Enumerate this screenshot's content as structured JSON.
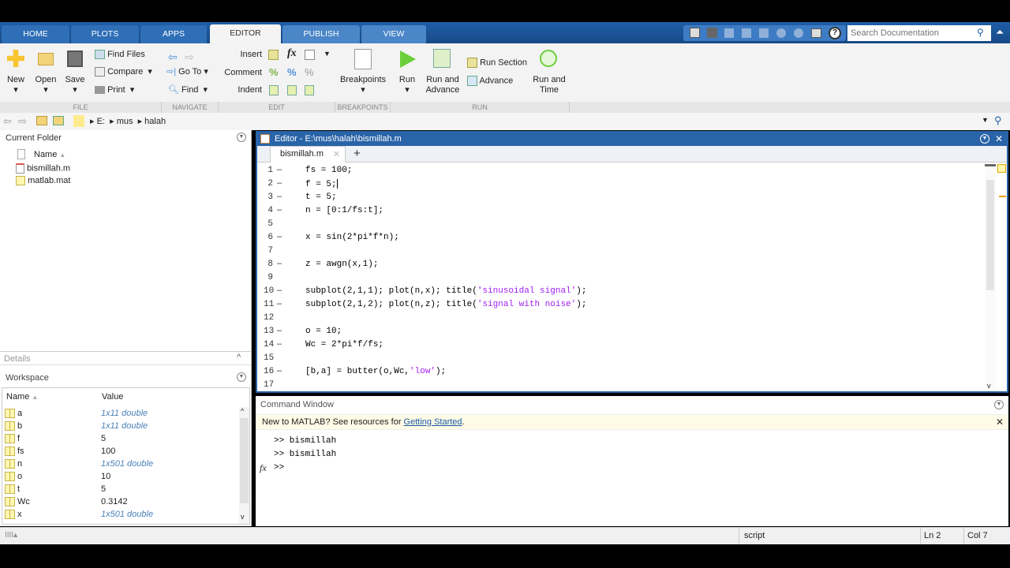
{
  "tabs": [
    "HOME",
    "PLOTS",
    "APPS",
    "EDITOR",
    "PUBLISH",
    "VIEW"
  ],
  "active_tab": "EDITOR",
  "quick_search": {
    "placeholder": "Search Documentation"
  },
  "ribbon": {
    "file": {
      "new": "New",
      "open": "Open",
      "save": "Save",
      "find_files": "Find Files",
      "compare": "Compare",
      "print": "Print",
      "label": "FILE"
    },
    "navigate": {
      "goto": "Go To",
      "find": "Find",
      "label": "NAVIGATE"
    },
    "edit": {
      "insert": "Insert",
      "comment": "Comment",
      "indent": "Indent",
      "label": "EDIT"
    },
    "breakpoints": {
      "btn": "Breakpoints",
      "label": "BREAKPOINTS"
    },
    "run": {
      "run": "Run",
      "run_advance": "Run and Advance",
      "run_section": "Run Section",
      "advance": "Advance",
      "run_time": "Run and Time",
      "label": "RUN"
    }
  },
  "path": [
    "E:",
    "mus",
    "halah"
  ],
  "current_folder": {
    "title": "Current Folder",
    "col": "Name",
    "files": [
      "bismillah.m",
      "matlab.mat"
    ]
  },
  "details": {
    "title": "Details"
  },
  "workspace": {
    "title": "Workspace",
    "col_name": "Name",
    "col_value": "Value",
    "vars": [
      {
        "n": "a",
        "v": "1x11 double",
        "i": true
      },
      {
        "n": "b",
        "v": "1x11 double",
        "i": true
      },
      {
        "n": "f",
        "v": "5",
        "i": false
      },
      {
        "n": "fs",
        "v": "100",
        "i": false
      },
      {
        "n": "n",
        "v": "1x501 double",
        "i": true
      },
      {
        "n": "o",
        "v": "10",
        "i": false
      },
      {
        "n": "t",
        "v": "5",
        "i": false
      },
      {
        "n": "Wc",
        "v": "0.3142",
        "i": false
      },
      {
        "n": "x",
        "v": "1x501 double",
        "i": true
      }
    ]
  },
  "editor": {
    "title": "Editor - E:\\mus\\halah\\bismillah.m",
    "tab": "bismillah.m",
    "lines": [
      {
        "n": "1",
        "exec": true,
        "code": [
          [
            "fs = 100;",
            ""
          ]
        ]
      },
      {
        "n": "2",
        "exec": true,
        "code": [
          [
            "f = 5;",
            ""
          ]
        ]
      },
      {
        "n": "3",
        "exec": true,
        "code": [
          [
            "t = 5;",
            ""
          ]
        ]
      },
      {
        "n": "4",
        "exec": true,
        "code": [
          [
            "n = [0:1/fs:t];",
            ""
          ]
        ]
      },
      {
        "n": "5",
        "exec": false,
        "code": []
      },
      {
        "n": "6",
        "exec": true,
        "code": [
          [
            "x = sin(2*pi*f*n);",
            ""
          ]
        ]
      },
      {
        "n": "7",
        "exec": false,
        "code": []
      },
      {
        "n": "8",
        "exec": true,
        "code": [
          [
            "z = awgn(x,1);",
            ""
          ]
        ]
      },
      {
        "n": "9",
        "exec": false,
        "code": []
      },
      {
        "n": "10",
        "exec": true,
        "code": [
          [
            "subplot(2,1,1); plot(n,x); title(",
            ""
          ],
          [
            "'sinusoidal signal'",
            "str"
          ],
          [
            ");",
            ""
          ]
        ]
      },
      {
        "n": "11",
        "exec": true,
        "code": [
          [
            "subplot(2,1,2); plot(n,z); title(",
            ""
          ],
          [
            "'signal with noise'",
            "str"
          ],
          [
            ");",
            ""
          ]
        ]
      },
      {
        "n": "12",
        "exec": false,
        "code": []
      },
      {
        "n": "13",
        "exec": true,
        "code": [
          [
            "o = 10;",
            ""
          ]
        ]
      },
      {
        "n": "14",
        "exec": true,
        "code": [
          [
            "Wc = 2*pi*f/fs;",
            ""
          ]
        ]
      },
      {
        "n": "15",
        "exec": false,
        "code": []
      },
      {
        "n": "16",
        "exec": true,
        "code": [
          [
            "[b,a] = butter(o,Wc,",
            ""
          ],
          [
            "'low'",
            "str"
          ],
          [
            ");",
            ""
          ]
        ]
      },
      {
        "n": "17",
        "exec": false,
        "code": []
      }
    ]
  },
  "command_window": {
    "title": "Command Window",
    "notice": "New to MATLAB? See resources for ",
    "notice_link": "Getting Started",
    "notice_end": ".",
    "history": [
      ">> bismillah",
      ">> bismillah"
    ],
    "prompt": ">>"
  },
  "status": {
    "mode": "script",
    "ln": "Ln  2",
    "col": "Col  7"
  },
  "colors": {
    "accent": "#2a64a8",
    "string": "#a020f0"
  }
}
